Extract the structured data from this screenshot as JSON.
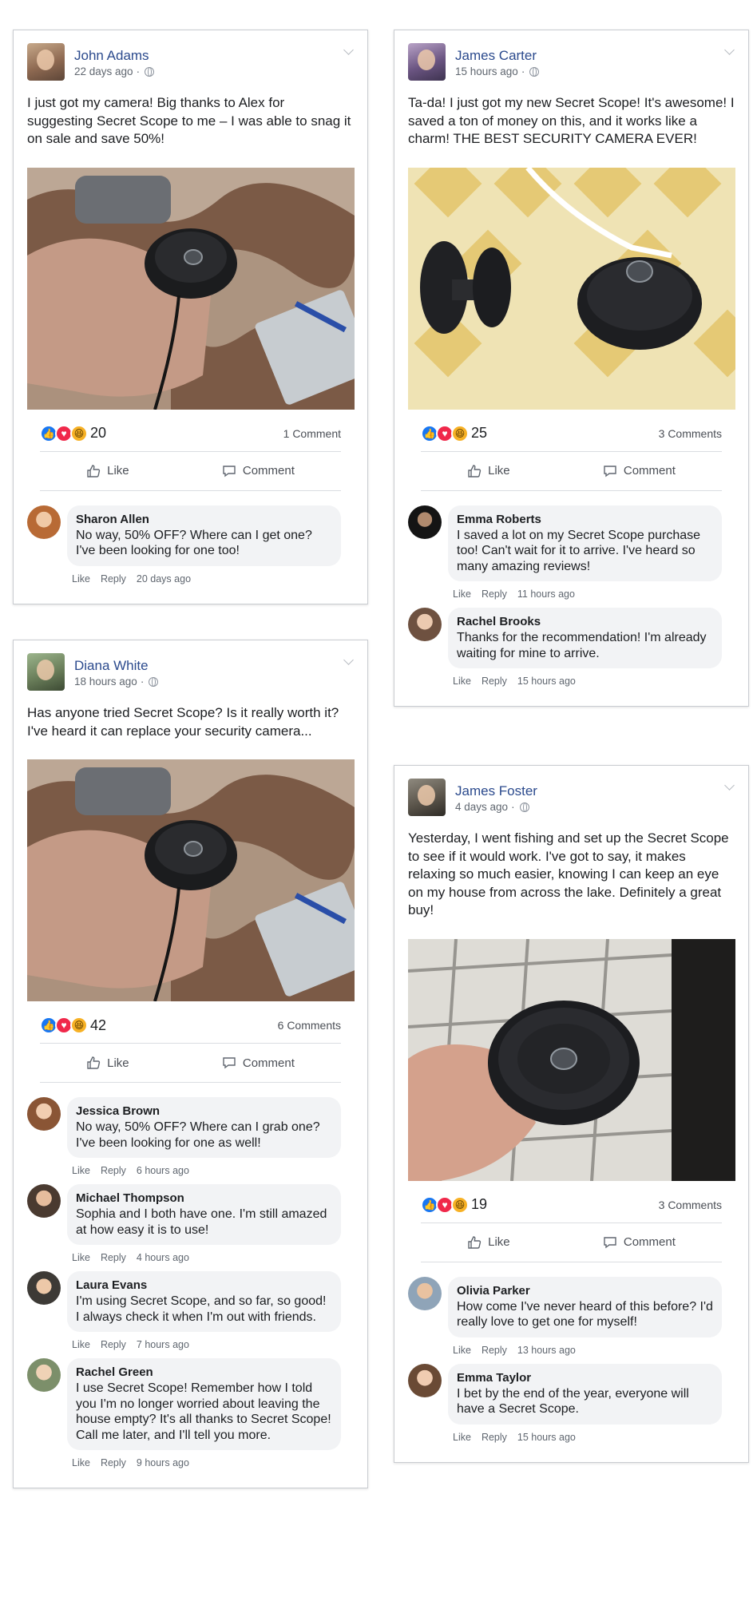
{
  "labels": {
    "like": "Like",
    "comment": "Comment",
    "reply": "Reply"
  },
  "posts": [
    {
      "author": "John Adams",
      "time": "22 days ago",
      "text": "I just got my camera! Big thanks to Alex for suggesting Secret Scope to me – I was able to snag it on sale and save 50%!",
      "reaction_count": "20",
      "comments_count": "1 Comment",
      "comments": [
        {
          "name": "Sharon Allen",
          "text": "No way, 50% OFF? Where can I get one? I've been looking for one too!",
          "time": "20 days ago"
        }
      ]
    },
    {
      "author": "James Carter",
      "time": "15 hours ago",
      "text": "Ta-da! I just got my new Secret Scope! It's awesome! I saved a ton of money on this, and it works like a charm! THE BEST SECURITY CAMERA EVER!",
      "reaction_count": "25",
      "comments_count": "3 Comments",
      "comments": [
        {
          "name": "Emma Roberts",
          "text": "I saved a lot on my Secret Scope purchase too! Can't wait for it to arrive. I've heard so many amazing reviews!",
          "time": "11 hours ago"
        },
        {
          "name": "Rachel Brooks",
          "text": "Thanks for the recommendation! I'm already waiting for mine to arrive.",
          "time": "15 hours ago"
        }
      ]
    },
    {
      "author": "Diana White",
      "time": "18 hours ago",
      "text": "Has anyone tried Secret Scope? Is it really worth it? I've heard it can replace your security camera...",
      "reaction_count": "42",
      "comments_count": "6 Comments",
      "comments": [
        {
          "name": "Jessica Brown",
          "text": "No way, 50% OFF? Where can I grab one? I've been looking for one as well!",
          "time": "6 hours ago"
        },
        {
          "name": "Michael Thompson",
          "text": "Sophia and I both have one. I'm still amazed at how easy it is to use!",
          "time": "4 hours ago"
        },
        {
          "name": "Laura Evans",
          "text": "I'm using Secret Scope, and so far, so good! I always check it when I'm out with friends.",
          "time": "7 hours ago"
        },
        {
          "name": "Rachel Green",
          "text": "I use Secret Scope! Remember how I told you I'm no longer worried about leaving the house empty? It's all thanks to Secret Scope! Call me later, and I'll tell you more.",
          "time": "9 hours ago"
        }
      ]
    },
    {
      "author": "James Foster",
      "time": "4 days ago",
      "text": "Yesterday, I went fishing and set up the Secret Scope to see if it would work. I've got to say, it makes relaxing so much easier, knowing I can keep an eye on my house from across the lake. Definitely a great buy!",
      "reaction_count": "19",
      "comments_count": "3 Comments",
      "comments": [
        {
          "name": "Olivia Parker",
          "text": "How come I've never heard of this before? I'd really love to get one for myself!",
          "time": "13 hours ago"
        },
        {
          "name": "Emma Taylor",
          "text": "I bet by the end of the year, everyone will have a Secret Scope.",
          "time": "15 hours ago"
        }
      ]
    }
  ]
}
